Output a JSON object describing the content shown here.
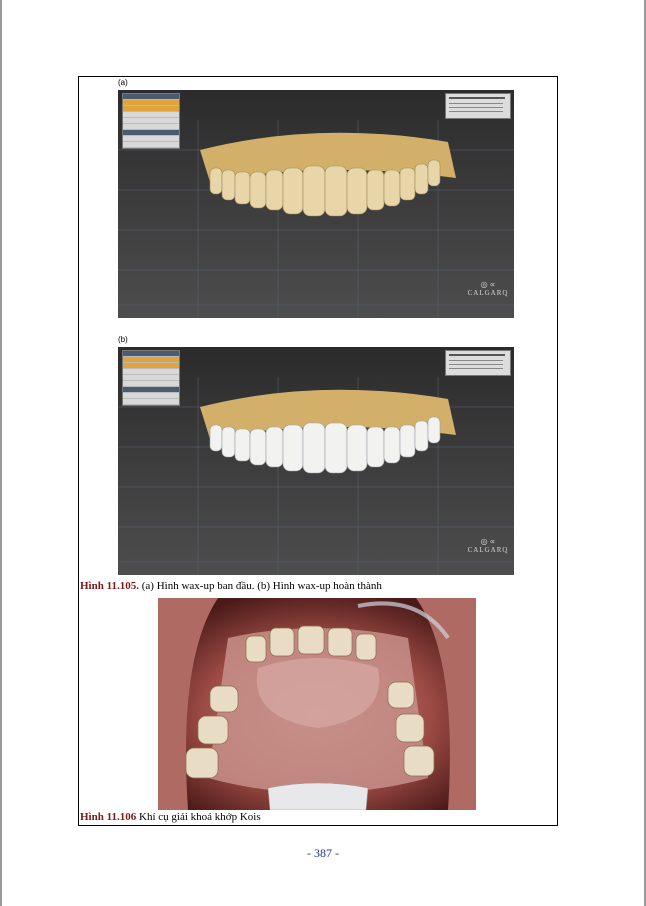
{
  "figure_a": {
    "panel_label": "(a)",
    "brand_name": "CALGARQ",
    "tooth_color": "#e8d6a8",
    "gum_color": "#d2b06a"
  },
  "figure_b": {
    "panel_label": "(b)",
    "brand_name": "CALGARQ",
    "tooth_color": "#f2f2f0",
    "gum_color": "#d2b06a"
  },
  "caption_105": {
    "number": "Hình 11.105.",
    "text": " (a) Hình wax-up ban đầu.      (b) Hình wax-up hoàn thành"
  },
  "caption_106": {
    "number": "Hình 11.106",
    "text": " Khí cụ giải khoá khớp Kois"
  },
  "page_number": "- 387 -"
}
